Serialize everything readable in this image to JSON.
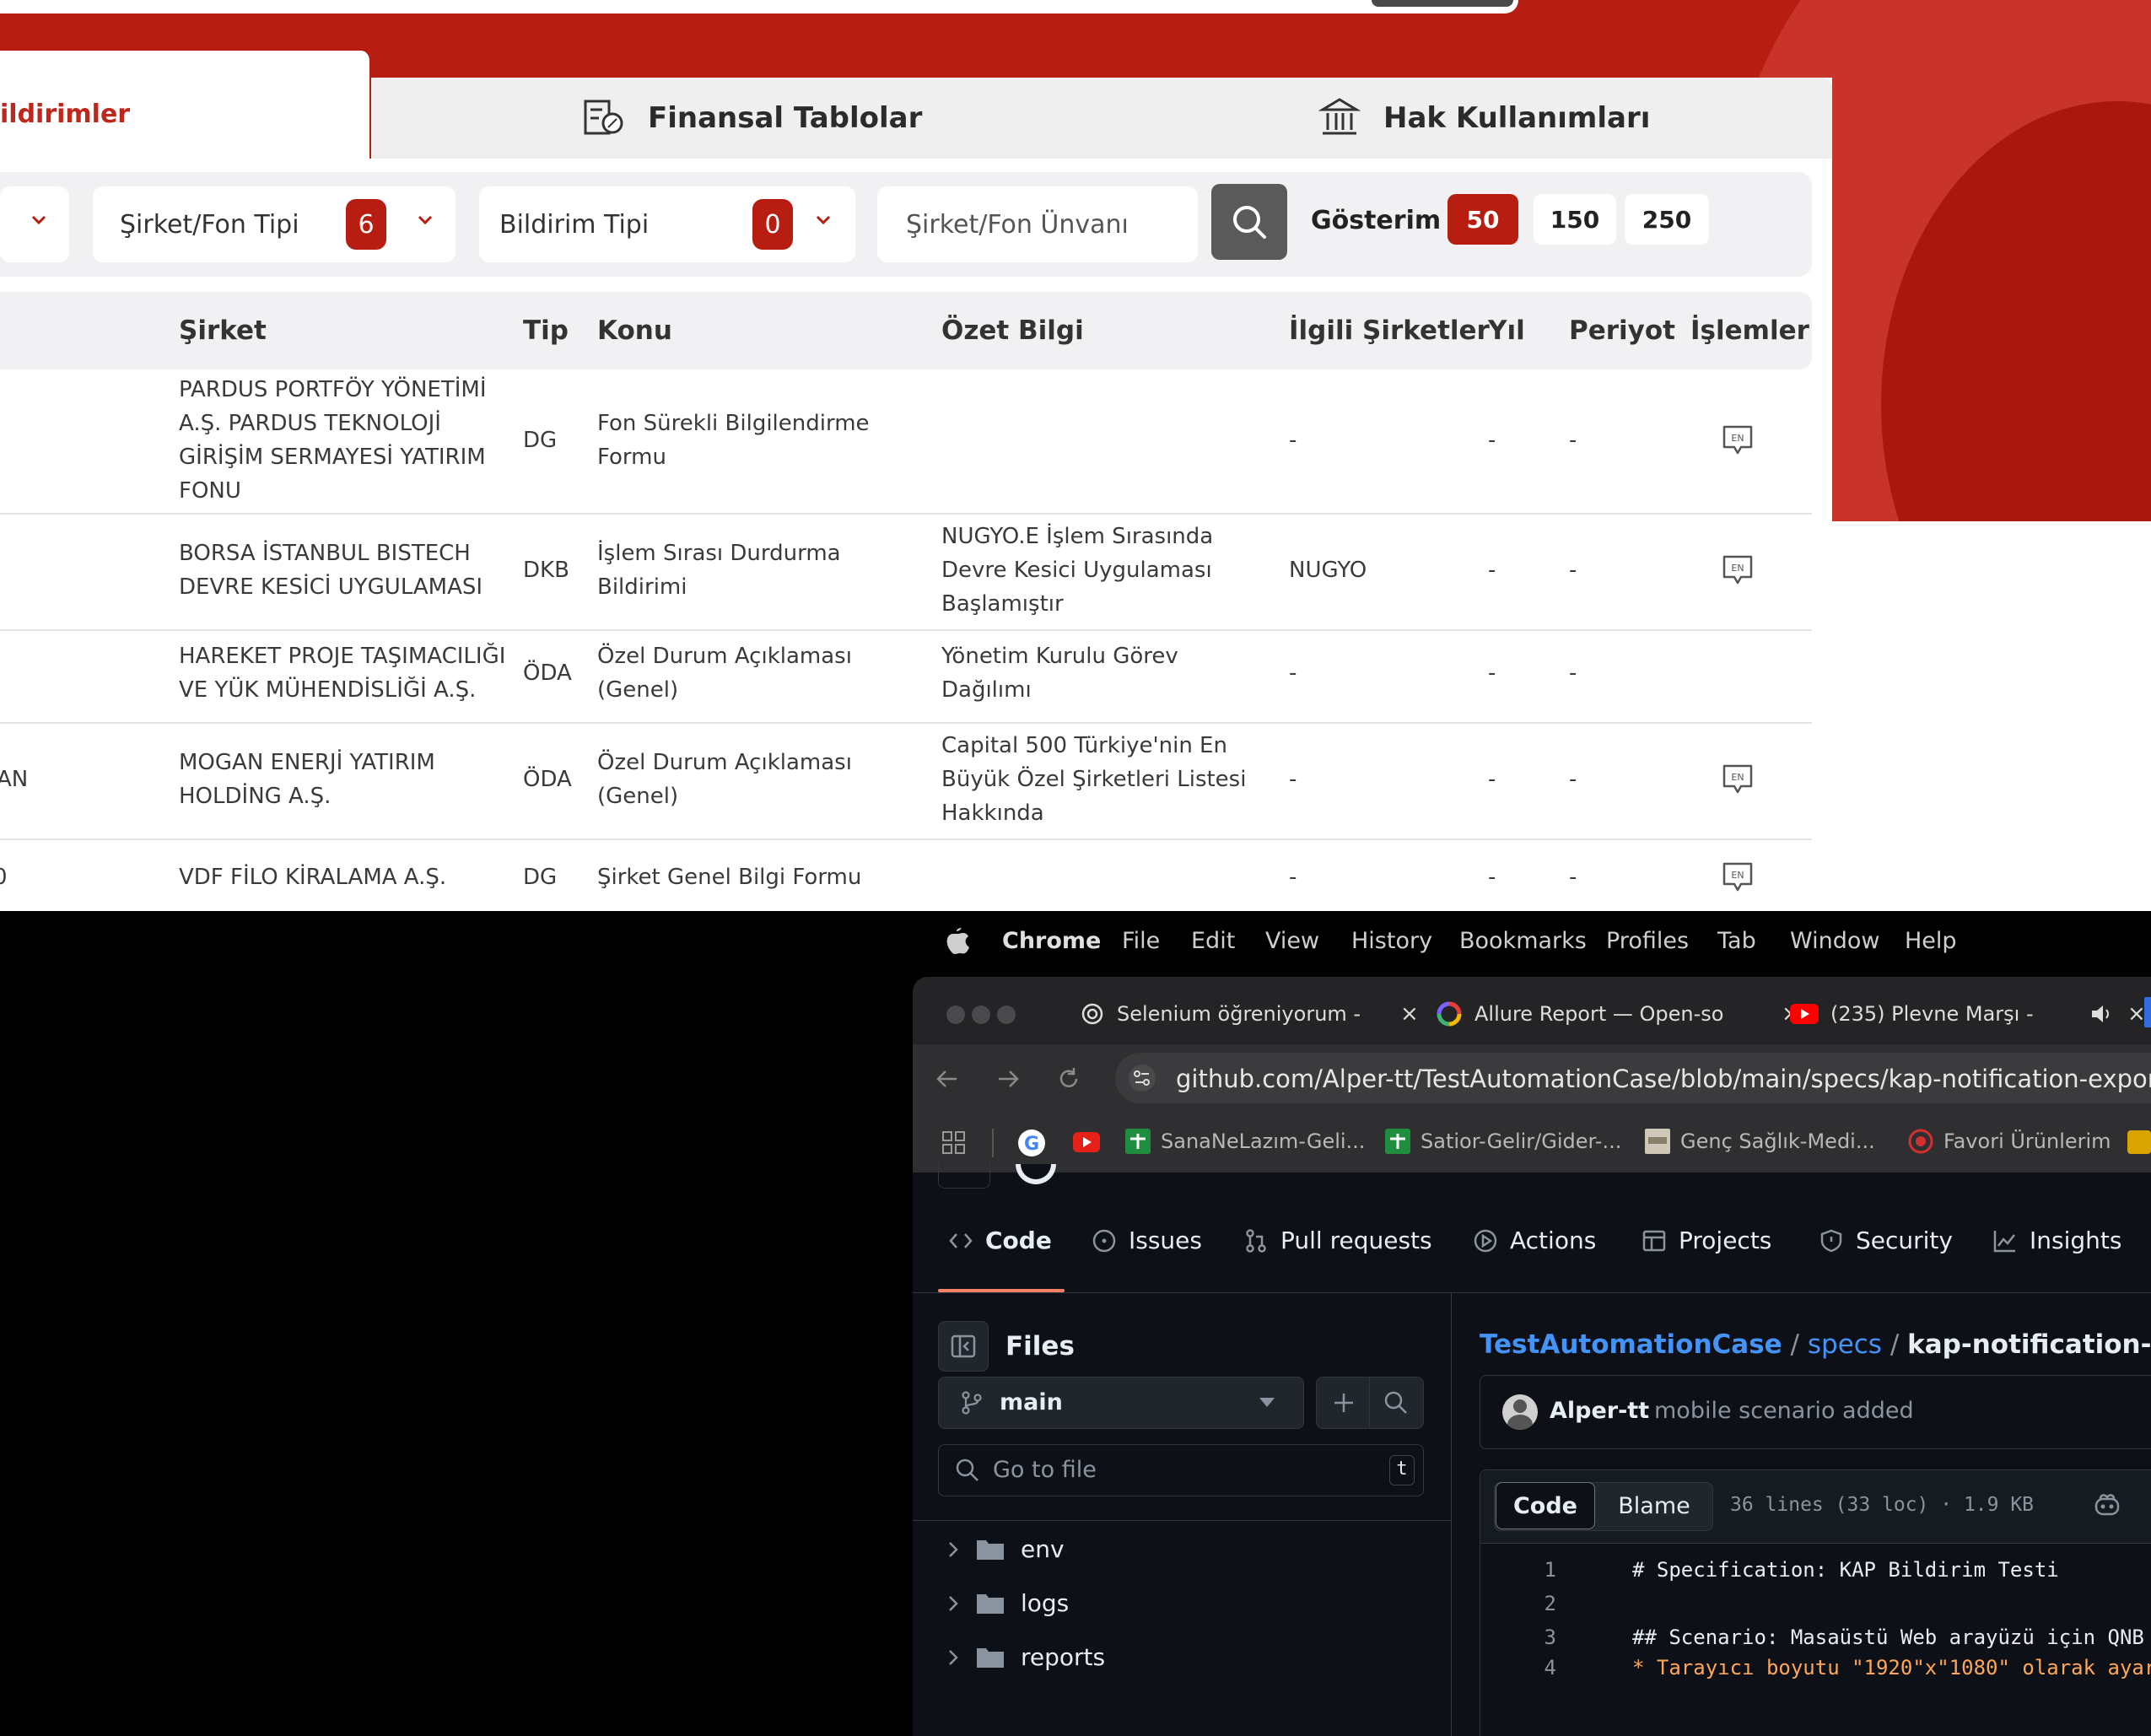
{
  "kap": {
    "tabs": {
      "active": "ildirimler",
      "finansal": "Finansal Tablolar",
      "hak": "Hak Kullanımları"
    },
    "filters": {
      "sirket_fon_tipi": {
        "label": "Şirket/Fon Tipi",
        "count": "6"
      },
      "bildirim_tipi": {
        "label": "Bildirim Tipi",
        "count": "0"
      },
      "unvan_placeholder": "Şirket/Fon Ünvanı",
      "gosterim_label": "Gösterim",
      "page_sizes": [
        "50",
        "150",
        "250"
      ]
    },
    "table": {
      "headers": {
        "sirket": "Şirket",
        "tip": "Tip",
        "konu": "Konu",
        "ozet": "Özet Bilgi",
        "ilgili": "İlgili Şirketler",
        "yil": "Yıl",
        "periyot": "Periyot",
        "islemler": "İşlemler"
      },
      "rows": [
        {
          "left": "",
          "sirket": [
            "PARDUS PORTFÖY YÖNETİMİ",
            "A.Ş. PARDUS TEKNOLOJİ",
            "GİRİŞİM SERMAYESİ YATIRIM",
            "FONU"
          ],
          "tip": "DG",
          "konu": [
            "Fon Sürekli Bilgilendirme",
            "Formu"
          ],
          "ozet": [],
          "ilgili": "-",
          "yil": "-",
          "periyot": "-",
          "en": "EN"
        },
        {
          "left": "",
          "sirket": [
            "BORSA İSTANBUL BISTECH",
            "DEVRE KESİCİ UYGULAMASI"
          ],
          "tip": "DKB",
          "konu": [
            "İşlem Sırası Durdurma",
            "Bildirimi"
          ],
          "ozet": [
            "NUGYO.E İşlem Sırasında",
            "Devre Kesici Uygulaması",
            "Başlamıştır"
          ],
          "ilgili": "NUGYO",
          "yil": "-",
          "periyot": "-",
          "en": "EN"
        },
        {
          "left": "-",
          "sirket": [
            "HAREKET PROJE TAŞIMACILIĞI",
            "VE YÜK MÜHENDİSLİĞİ A.Ş."
          ],
          "tip": "ÖDA",
          "konu": [
            "Özel Durum Açıklaması",
            "(Genel)"
          ],
          "ozet": [
            "Yönetim Kurulu Görev",
            "Dağılımı"
          ],
          "ilgili": "-",
          "yil": "-",
          "periyot": "-",
          "en": ""
        },
        {
          "left": "AN",
          "sirket": [
            "MOGAN ENERJİ YATIRIM",
            "HOLDİNG A.Ş."
          ],
          "tip": "ÖDA",
          "konu": [
            "Özel Durum Açıklaması",
            "(Genel)"
          ],
          "ozet": [
            "Capital 500 Türkiye'nin En",
            "Büyük Özel Şirketleri Listesi",
            "Hakkında"
          ],
          "ilgili": "-",
          "yil": "-",
          "periyot": "-",
          "en": "EN"
        },
        {
          "left": "0",
          "sirket": [
            "VDF FİLO KİRALAMA A.Ş."
          ],
          "tip": "DG",
          "konu": [
            "Şirket Genel Bilgi Formu"
          ],
          "ozet": [],
          "ilgili": "-",
          "yil": "-",
          "periyot": "-",
          "en": "EN"
        }
      ]
    }
  },
  "mac": {
    "menubar": [
      "Chrome",
      "File",
      "Edit",
      "View",
      "History",
      "Bookmarks",
      "Profiles",
      "Tab",
      "Window",
      "Help"
    ]
  },
  "chrome": {
    "tabs": [
      {
        "title": "Selenium öğreniyorum - "
      },
      {
        "title": "Allure Report — Open-so"
      },
      {
        "title": "(235) Plevne Marşı - "
      }
    ],
    "url": "github.com/Alper-tt/TestAutomationCase/blob/main/specs/kap-notification-export.spec",
    "bookmarks": [
      "SanaNeLazım-Geli...",
      "Satior-Gelir/Gider-...",
      "Genç Sağlık-Medi...",
      "Favori Ürünlerim"
    ]
  },
  "github": {
    "repo_tabs": [
      "Code",
      "Issues",
      "Pull requests",
      "Actions",
      "Projects",
      "Security",
      "Insights"
    ],
    "files_title": "Files",
    "branch": "main",
    "goto_placeholder": "Go to file",
    "goto_shortcut": "t",
    "tree": [
      "env",
      "logs",
      "reports"
    ],
    "breadcrumb": {
      "repo": "TestAutomationCase",
      "sep1": "/",
      "folder": "specs",
      "sep2": "/",
      "file": "kap-notification-expor"
    },
    "commit": {
      "author": "Alper-tt",
      "message": "mobile scenario added"
    },
    "code_tabs": {
      "code": "Code",
      "blame": "Blame"
    },
    "file_info": "36 lines (33 loc) · 1.9 KB",
    "code_lines": [
      {
        "n": "1",
        "text": "# Specification: KAP Bildirim Testi"
      },
      {
        "n": "2",
        "text": ""
      },
      {
        "n": "3",
        "text": "## Scenario: Masaüstü Web arayüzü için QNB"
      },
      {
        "n": "4",
        "text": "* Tarayıcı boyutu \"1920\"x\"1080\" olarak ayar"
      }
    ]
  },
  "colors": {
    "kap_red": "#b81d12",
    "gh_bg": "#0d1117",
    "gh_link": "#4493f8"
  }
}
